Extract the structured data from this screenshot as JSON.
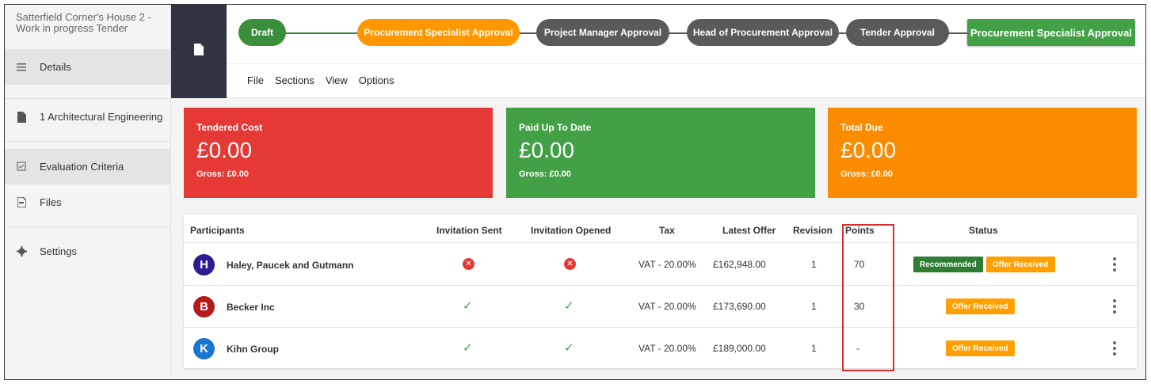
{
  "sidebar": {
    "title": "Satterfield Corner's House 2 - Work in progress Tender",
    "items": [
      {
        "label": "Details",
        "icon": "list-icon"
      },
      {
        "label": "1 Architectural Engineering",
        "icon": "document-icon"
      },
      {
        "label": "Evaluation Criteria",
        "icon": "checklist-icon"
      },
      {
        "label": "Files",
        "icon": "file-icon"
      },
      {
        "label": "Settings",
        "icon": "gear-icon"
      }
    ]
  },
  "workflow": {
    "steps": [
      {
        "label": "Draft",
        "state": "done"
      },
      {
        "label": "Procurement Specialist Approval",
        "state": "current"
      },
      {
        "label": "Project Manager Approval",
        "state": "pending"
      },
      {
        "label": "Head of Procurement Approval",
        "state": "pending"
      },
      {
        "label": "Tender Approval",
        "state": "pending"
      }
    ],
    "action_label": "Procurement Specialist Approval"
  },
  "menu": {
    "file": "File",
    "sections": "Sections",
    "view": "View",
    "options": "Options"
  },
  "cards": [
    {
      "title": "Tendered Cost",
      "value": "£0.00",
      "gross": "Gross: £0.00",
      "color": "#e53935"
    },
    {
      "title": "Paid Up To Date",
      "value": "£0.00",
      "gross": "Gross: £0.00",
      "color": "#43a047"
    },
    {
      "title": "Total Due",
      "value": "£0.00",
      "gross": "Gross: £0.00",
      "color": "#fb8c00"
    }
  ],
  "table": {
    "headers": {
      "participants": "Participants",
      "invitation_sent": "Invitation Sent",
      "invitation_opened": "Invitation Opened",
      "tax": "Tax",
      "latest_offer": "Latest Offer",
      "revision": "Revision",
      "points": "Points",
      "status": "Status"
    },
    "rows": [
      {
        "initial": "H",
        "avatar_color": "#311b92",
        "name": "Haley, Paucek and Gutmann",
        "invitation_sent": "no",
        "invitation_opened": "no",
        "tax": "VAT - 20.00%",
        "latest_offer": "£162,948.00",
        "revision": "1",
        "points": "70",
        "status_recommended": "Recommended",
        "status_offer": "Offer Received"
      },
      {
        "initial": "B",
        "avatar_color": "#b71c1c",
        "name": "Becker Inc",
        "invitation_sent": "yes",
        "invitation_opened": "yes",
        "tax": "VAT - 20.00%",
        "latest_offer": "£173,690.00",
        "revision": "1",
        "points": "30",
        "status_offer": "Offer Received"
      },
      {
        "initial": "K",
        "avatar_color": "#1976d2",
        "name": "Kihn Group",
        "invitation_sent": "yes",
        "invitation_opened": "yes",
        "tax": "VAT - 20.00%",
        "latest_offer": "£189,000.00",
        "revision": "1",
        "points": "-",
        "status_offer": "Offer Received"
      }
    ]
  }
}
